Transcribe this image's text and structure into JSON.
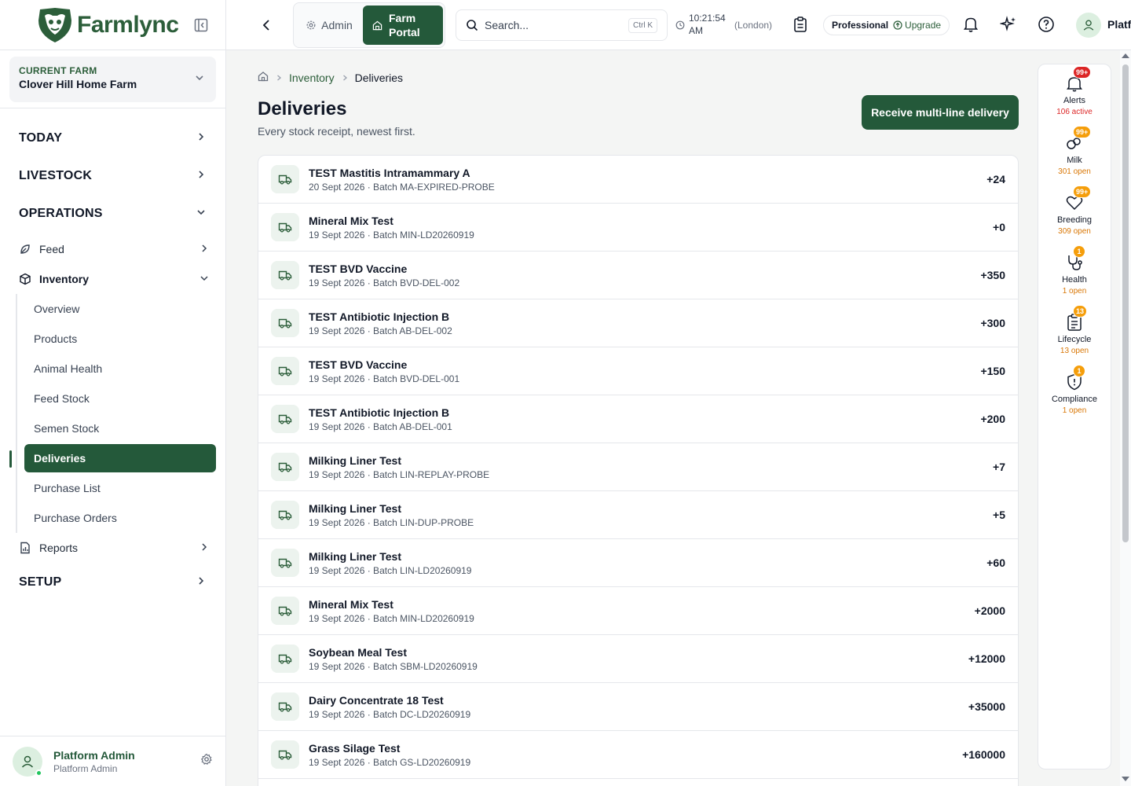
{
  "app": {
    "name": "Farmlync"
  },
  "farm": {
    "label": "CURRENT FARM",
    "name": "Clover Hill Home Farm"
  },
  "nav": {
    "today": "TODAY",
    "livestock": "LIVESTOCK",
    "operations": "OPERATIONS",
    "feed": "Feed",
    "inventory": "Inventory",
    "inventory_items": [
      "Overview",
      "Products",
      "Animal Health",
      "Feed Stock",
      "Semen Stock",
      "Deliveries",
      "Purchase List",
      "Purchase Orders"
    ],
    "reports": "Reports",
    "setup": "SETUP"
  },
  "user": {
    "name": "Platform Admin",
    "role": "Platform Admin"
  },
  "topbar": {
    "admin": "Admin",
    "farm_portal": "Farm Portal",
    "search_placeholder": "Search...",
    "search_shortcut": "Ctrl K",
    "time": "10:21:54 AM",
    "timezone": "(London)",
    "plan": "Professional",
    "upgrade": "Upgrade",
    "user_short": "Platf"
  },
  "breadcrumb": {
    "section": "Inventory",
    "current": "Deliveries"
  },
  "page": {
    "title": "Deliveries",
    "subtitle": "Every stock receipt, newest first.",
    "primary_action": "Receive multi-line delivery"
  },
  "deliveries": [
    {
      "name": "TEST Mastitis Intramammary A",
      "meta": "20 Sept 2026 · Batch MA-EXPIRED-PROBE",
      "qty": "+24"
    },
    {
      "name": "Mineral Mix Test",
      "meta": "19 Sept 2026 · Batch MIN-LD20260919",
      "qty": "+0"
    },
    {
      "name": "TEST BVD Vaccine",
      "meta": "19 Sept 2026 · Batch BVD-DEL-002",
      "qty": "+350"
    },
    {
      "name": "TEST Antibiotic Injection B",
      "meta": "19 Sept 2026 · Batch AB-DEL-002",
      "qty": "+300"
    },
    {
      "name": "TEST BVD Vaccine",
      "meta": "19 Sept 2026 · Batch BVD-DEL-001",
      "qty": "+150"
    },
    {
      "name": "TEST Antibiotic Injection B",
      "meta": "19 Sept 2026 · Batch AB-DEL-001",
      "qty": "+200"
    },
    {
      "name": "Milking Liner Test",
      "meta": "19 Sept 2026 · Batch LIN-REPLAY-PROBE",
      "qty": "+7"
    },
    {
      "name": "Milking Liner Test",
      "meta": "19 Sept 2026 · Batch LIN-DUP-PROBE",
      "qty": "+5"
    },
    {
      "name": "Milking Liner Test",
      "meta": "19 Sept 2026 · Batch LIN-LD20260919",
      "qty": "+60"
    },
    {
      "name": "Mineral Mix Test",
      "meta": "19 Sept 2026 · Batch MIN-LD20260919",
      "qty": "+2000"
    },
    {
      "name": "Soybean Meal Test",
      "meta": "19 Sept 2026 · Batch SBM-LD20260919",
      "qty": "+12000"
    },
    {
      "name": "Dairy Concentrate 18 Test",
      "meta": "19 Sept 2026 · Batch DC-LD20260919",
      "qty": "+35000"
    },
    {
      "name": "Grass Silage Test",
      "meta": "19 Sept 2026 · Batch GS-LD20260919",
      "qty": "+160000"
    }
  ],
  "rail": [
    {
      "label": "Alerts",
      "sub": "106 active",
      "badge": "99+",
      "icon": "bell-icon",
      "badge_color": "#dc2626",
      "sub_color": "#dc2626"
    },
    {
      "label": "Milk",
      "sub": "301 open",
      "badge": "99+",
      "icon": "milk-icon",
      "badge_color": "#f59e0b",
      "sub_color": "#d97706"
    },
    {
      "label": "Breeding",
      "sub": "309 open",
      "badge": "99+",
      "icon": "heart-icon",
      "badge_color": "#f59e0b",
      "sub_color": "#d97706"
    },
    {
      "label": "Health",
      "sub": "1 open",
      "badge": "1",
      "icon": "stethoscope-icon",
      "badge_color": "#f59e0b",
      "sub_color": "#d97706"
    },
    {
      "label": "Lifecycle",
      "sub": "13 open",
      "badge": "13",
      "icon": "clipboard-icon",
      "badge_color": "#f59e0b",
      "sub_color": "#d97706"
    },
    {
      "label": "Compliance",
      "sub": "1 open",
      "badge": "1",
      "icon": "shield-icon",
      "badge_color": "#f59e0b",
      "sub_color": "#d97706"
    }
  ],
  "colors": {
    "brand": "#24593a",
    "brand_light": "#ecf3ee"
  }
}
